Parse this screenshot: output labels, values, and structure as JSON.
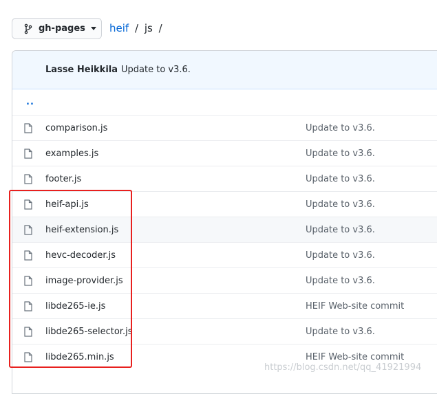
{
  "branch": {
    "label": "gh-pages"
  },
  "breadcrumb": {
    "repo": "heif",
    "sep1": "/",
    "folder": "js",
    "sep2": "/"
  },
  "latest_commit": {
    "author": "Lasse Heikkila",
    "message": "Update to v3.6."
  },
  "parent_link": "..",
  "files": [
    {
      "name": "comparison.js",
      "message": "Update to v3.6."
    },
    {
      "name": "examples.js",
      "message": "Update to v3.6."
    },
    {
      "name": "footer.js",
      "message": "Update to v3.6."
    },
    {
      "name": "heif-api.js",
      "message": "Update to v3.6."
    },
    {
      "name": "heif-extension.js",
      "message": "Update to v3.6."
    },
    {
      "name": "hevc-decoder.js",
      "message": "Update to v3.6."
    },
    {
      "name": "image-provider.js",
      "message": "Update to v3.6."
    },
    {
      "name": "libde265-ie.js",
      "message": "HEIF Web-site commit"
    },
    {
      "name": "libde265-selector.js",
      "message": "Update to v3.6."
    },
    {
      "name": "libde265.min.js",
      "message": "HEIF Web-site commit"
    }
  ],
  "watermark": "https://blog.csdn.net/qq_41921994",
  "colors": {
    "link": "#0366d6",
    "annotation": "#e8201e",
    "header_bg": "#f1f8ff"
  }
}
